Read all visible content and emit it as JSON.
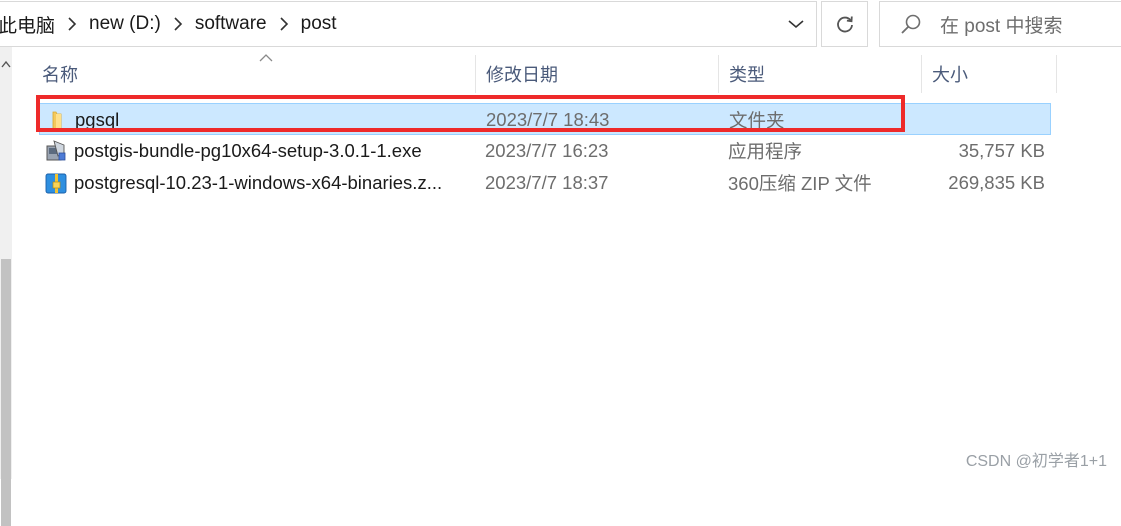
{
  "address_bar": {
    "breadcrumbs": [
      "此电脑",
      "new (D:)",
      "software",
      "post"
    ]
  },
  "search": {
    "placeholder": "在 post 中搜索"
  },
  "columns": {
    "name": "名称",
    "date_modified": "修改日期",
    "type": "类型",
    "size": "大小",
    "sort_indicator": "ascending"
  },
  "files": [
    {
      "name": "pgsql",
      "date": "2023/7/7 18:43",
      "type": "文件夹",
      "size": "",
      "icon": "folder-icon",
      "selected": true
    },
    {
      "name": "postgis-bundle-pg10x64-setup-3.0.1-1.exe",
      "date": "2023/7/7 16:23",
      "type": "应用程序",
      "size": "35,757 KB",
      "icon": "installer-icon",
      "selected": false
    },
    {
      "name": "postgresql-10.23-1-windows-x64-binaries.z...",
      "date": "2023/7/7 18:37",
      "type": "360压缩 ZIP 文件",
      "size": "269,835 KB",
      "icon": "zip-archive-icon",
      "selected": false
    }
  ],
  "watermark": "CSDN @初学者1+1",
  "colors": {
    "selection_bg": "#cce8ff",
    "selection_border": "#99d1ff",
    "highlight_box": "#ee2a2a",
    "header_text": "#4a5a7a"
  }
}
